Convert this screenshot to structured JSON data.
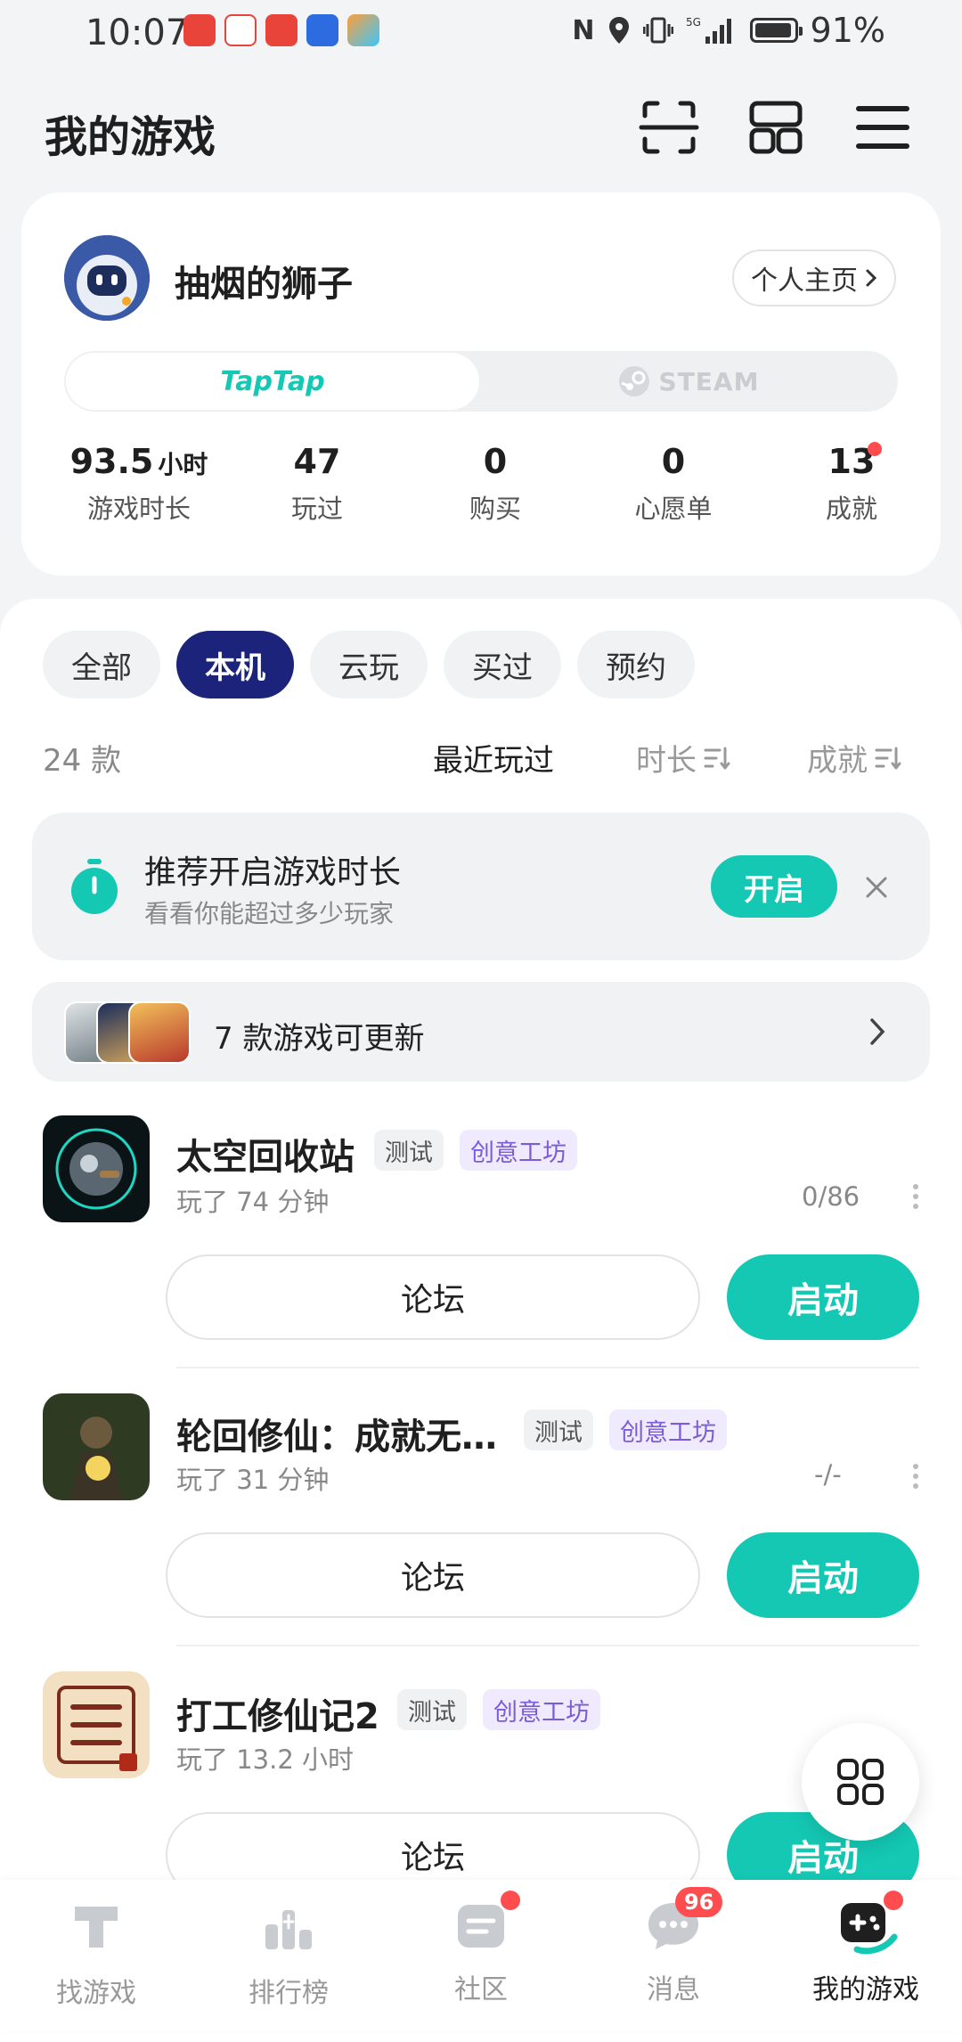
{
  "status_bar": {
    "time": "10:07",
    "network": "5G",
    "battery": "91%"
  },
  "header": {
    "title": "我的游戏"
  },
  "profile": {
    "username": "抽烟的狮子",
    "home_button": "个人主页",
    "platform_tabs": [
      "TapTap",
      "STEAM"
    ],
    "stats": [
      {
        "value": "93.5",
        "unit": "小时",
        "label": "游戏时长"
      },
      {
        "value": "47",
        "unit": "",
        "label": "玩过"
      },
      {
        "value": "0",
        "unit": "",
        "label": "购买"
      },
      {
        "value": "0",
        "unit": "",
        "label": "心愿单"
      },
      {
        "value": "13",
        "unit": "",
        "label": "成就"
      }
    ]
  },
  "filters": {
    "chips": [
      "全部",
      "本机",
      "云玩",
      "买过",
      "预约"
    ],
    "active": "本机"
  },
  "list_meta": {
    "count": "24 款",
    "sorts": [
      "最近玩过",
      "时长",
      "成就"
    ]
  },
  "tip": {
    "title": "推荐开启游戏时长",
    "subtitle": "看看你能超过多少玩家",
    "button": "开启"
  },
  "update_bar": {
    "text": "7 款游戏可更新"
  },
  "games": [
    {
      "title": "太空回收站",
      "tags": [
        "测试",
        "创意工坊"
      ],
      "played": "玩了 74 分钟",
      "progress": "0/86",
      "forum": "论坛",
      "start": "启动"
    },
    {
      "title": "轮回修仙：成就无…",
      "tags": [
        "测试",
        "创意工坊"
      ],
      "played": "玩了 31 分钟",
      "progress": "-/-",
      "forum": "论坛",
      "start": "启动"
    },
    {
      "title": "打工修仙记2",
      "tags": [
        "测试",
        "创意工坊"
      ],
      "played": "玩了 13.2 小时",
      "progress": "",
      "forum": "论坛",
      "start": "启动"
    }
  ],
  "bottom_nav": [
    {
      "label": "找游戏",
      "icon": "find-games-icon"
    },
    {
      "label": "排行榜",
      "icon": "ranking-icon"
    },
    {
      "label": "社区",
      "icon": "community-icon"
    },
    {
      "label": "消息",
      "icon": "message-icon",
      "badge": "96"
    },
    {
      "label": "我的游戏",
      "icon": "my-games-icon",
      "active": true
    }
  ],
  "colors": {
    "accent": "#14c8b4",
    "chip_active": "#1b237a",
    "badge": "#ff4d4f",
    "workshop": "#7b5cd6"
  }
}
